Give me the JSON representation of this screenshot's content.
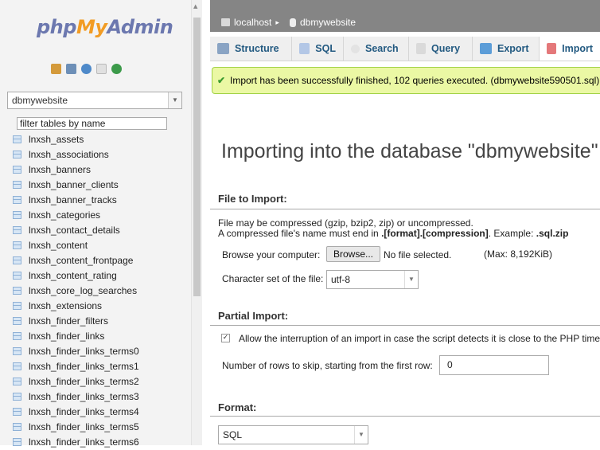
{
  "nav": {
    "logo": {
      "php": "php",
      "my": "My",
      "admin": "Admin"
    },
    "quick_icons": [
      "home-icon",
      "exit-icon",
      "help-icon",
      "docs-icon",
      "reload-icon"
    ],
    "database_select": "dbmywebsite",
    "filter_placeholder": "filter tables by name",
    "tables": [
      "lnxsh_assets",
      "lnxsh_associations",
      "lnxsh_banners",
      "lnxsh_banner_clients",
      "lnxsh_banner_tracks",
      "lnxsh_categories",
      "lnxsh_contact_details",
      "lnxsh_content",
      "lnxsh_content_frontpage",
      "lnxsh_content_rating",
      "lnxsh_core_log_searches",
      "lnxsh_extensions",
      "lnxsh_finder_filters",
      "lnxsh_finder_links",
      "lnxsh_finder_links_terms0",
      "lnxsh_finder_links_terms1",
      "lnxsh_finder_links_terms2",
      "lnxsh_finder_links_terms3",
      "lnxsh_finder_links_terms4",
      "lnxsh_finder_links_terms5",
      "lnxsh_finder_links_terms6"
    ]
  },
  "breadcrumb": {
    "server": "localhost",
    "database": "dbmywebsite"
  },
  "tabs": [
    {
      "label": "Structure",
      "icon": "structure-icon"
    },
    {
      "label": "SQL",
      "icon": "sql-icon"
    },
    {
      "label": "Search",
      "icon": "search-icon"
    },
    {
      "label": "Query",
      "icon": "query-icon"
    },
    {
      "label": "Export",
      "icon": "export-icon"
    },
    {
      "label": "Import",
      "icon": "import-icon"
    }
  ],
  "success_message": "Import has been successfully finished, 102 queries executed. (dbmywebsite590501.sql)",
  "page_title": "Importing into the database \"dbmywebsite\"",
  "file_to_import": {
    "heading": "File to Import:",
    "line1": "File may be compressed (gzip, bzip2, zip) or uncompressed.",
    "line2_prefix": "A compressed file's name must end in ",
    "line2_bold": ".[format].[compression]",
    "line2_mid": ". Example: ",
    "line2_example": ".sql.zip",
    "browse_label": "Browse your computer:",
    "browse_button": "Browse...",
    "no_file": "No file selected.",
    "max_size": "(Max: 8,192KiB)",
    "charset_label": "Character set of the file:",
    "charset_value": "utf-8"
  },
  "partial_import": {
    "heading": "Partial Import:",
    "allow_interrupt_label": "Allow the interruption of an import in case the script detects it is close to the PHP timeo",
    "allow_interrupt_checked": true,
    "skip_rows_label": "Number of rows to skip, starting from the first row:",
    "skip_rows_value": "0"
  },
  "format": {
    "heading": "Format:",
    "value": "SQL"
  },
  "colors": {
    "breadcrumb_bg": "#858585",
    "tab_text": "#235a81",
    "success_bg": "#ebf8a4",
    "success_border": "#a2d246"
  }
}
